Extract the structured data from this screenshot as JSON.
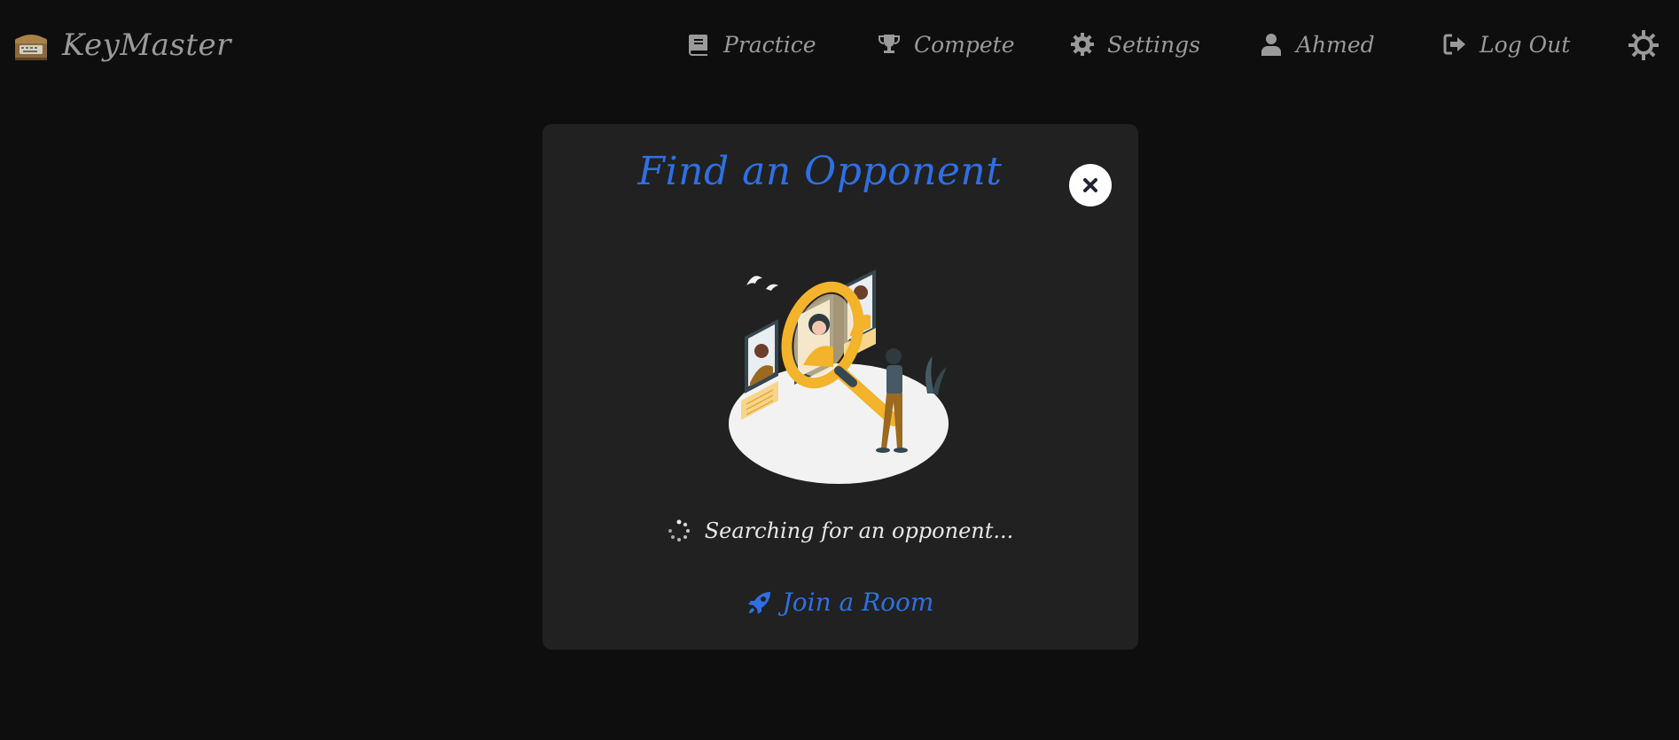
{
  "app": {
    "name": "KeyMaster"
  },
  "nav": {
    "items": [
      {
        "label": "Practice",
        "icon": "book-icon"
      },
      {
        "label": "Compete",
        "icon": "trophy-icon"
      },
      {
        "label": "Settings",
        "icon": "gear-icon"
      },
      {
        "label": "Ahmed",
        "icon": "user-icon"
      },
      {
        "label": "Log Out",
        "icon": "logout-icon"
      }
    ],
    "theme_toggle_icon": "sun-icon"
  },
  "modal": {
    "title": "Find an Opponent",
    "close_icon": "close-icon",
    "illustration": "opponent-search-illustration",
    "status_text": "Searching for an opponent...",
    "join_label": "Join a Room",
    "join_icon": "rocket-icon"
  },
  "colors": {
    "background": "#0e0e0e",
    "modal_background": "#212121",
    "accent": "#2f6fe4",
    "nav_text": "#9a9a9a",
    "illustration_yellow": "#f3b32a"
  }
}
